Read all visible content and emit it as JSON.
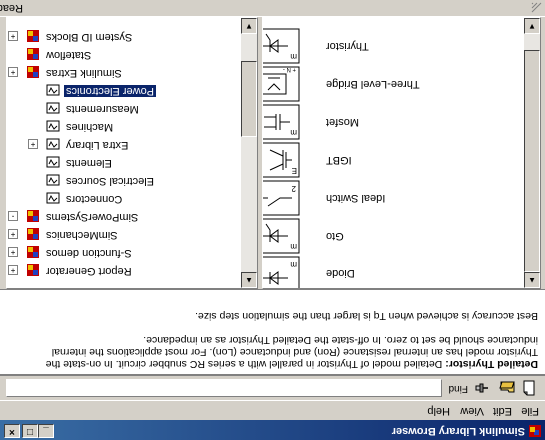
{
  "window": {
    "title": "Simulink Library Browser",
    "buttons": [
      "_",
      "□",
      "×"
    ]
  },
  "menubar": {
    "items": [
      "File",
      "Edit",
      "View",
      "Help"
    ]
  },
  "toolbar": {
    "find_label": "Find",
    "find_value": ""
  },
  "description": {
    "heading": "Detailed Thyristor:",
    "text": " Detailed model of Thyristor in parallel with a series RC snubber circuit. In on-state the Thyristor model has an internal resistance (Ron) and inductance (Lon). For most applications the internal inductance should be set to zero. In off-state the Detailed Thyristor as an impedance.\n\nBest accuracy is achieved when Tq is larger than the simulation step size."
  },
  "blocks": [
    {
      "label": "Diode",
      "icon": "diode-block-icon"
    },
    {
      "label": "Gto",
      "icon": "gto-block-icon"
    },
    {
      "label": "Ideal Switch",
      "icon": "ideal-switch-block-icon"
    },
    {
      "label": "IGBT",
      "icon": "igbt-block-icon"
    },
    {
      "label": "Mosfet",
      "icon": "mosfet-block-icon"
    },
    {
      "label": "Three-Level Bridge",
      "icon": "three-level-bridge-block-icon"
    },
    {
      "label": "Thyristor",
      "icon": "thyristor-block-icon"
    }
  ],
  "tree": [
    {
      "label": "Report Generator",
      "expand": "+",
      "icon": "library-icon",
      "indent": 0
    },
    {
      "label": "S-function demos",
      "expand": "+",
      "icon": "library-icon",
      "indent": 0
    },
    {
      "label": "SimMechanics",
      "expand": "+",
      "icon": "library-icon",
      "indent": 0
    },
    {
      "label": "SimPowerSystems",
      "expand": "-",
      "icon": "library-icon",
      "indent": 0
    },
    {
      "label": "Connectors",
      "expand": "",
      "icon": "sublibrary-icon",
      "indent": 1
    },
    {
      "label": "Electrical Sources",
      "expand": "",
      "icon": "sublibrary-icon",
      "indent": 1
    },
    {
      "label": "Elements",
      "expand": "",
      "icon": "sublibrary-icon",
      "indent": 1
    },
    {
      "label": "Extra Library",
      "expand": "+",
      "icon": "sublibrary-icon",
      "indent": 1
    },
    {
      "label": "Machines",
      "expand": "",
      "icon": "sublibrary-icon",
      "indent": 1
    },
    {
      "label": "Measurements",
      "expand": "",
      "icon": "sublibrary-icon",
      "indent": 1
    },
    {
      "label": "Power Electronics",
      "expand": "",
      "icon": "sublibrary-icon",
      "indent": 1,
      "selected": true
    },
    {
      "label": "Simulink Extras",
      "expand": "+",
      "icon": "library-icon",
      "indent": 0
    },
    {
      "label": "Stateflow",
      "expand": "",
      "icon": "library-icon",
      "indent": 0
    },
    {
      "label": "System ID Blocks",
      "expand": "+",
      "icon": "library-icon",
      "indent": 0
    }
  ],
  "status": {
    "text": "Ready"
  },
  "colors": {
    "titlebar": "#0a246a",
    "selection": "#0a246a",
    "face": "#d4d0c8"
  }
}
